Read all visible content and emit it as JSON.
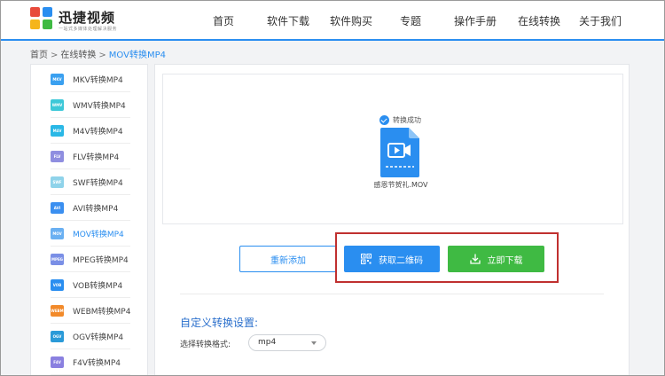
{
  "header": {
    "brand": "迅捷视频",
    "brand_sub": "一站式多媒体处理解决服务",
    "nav": [
      "首页",
      "软件下载",
      "软件购买",
      "专题",
      "操作手册",
      "在线转换",
      "关于我们"
    ]
  },
  "breadcrumb": {
    "home": "首页",
    "sep": ">",
    "section": "在线转换",
    "current": "MOV转换MP4"
  },
  "sidebar": {
    "items": [
      {
        "badge": "MKV",
        "label": "MKV转换MP4",
        "color": "#3aa0f0"
      },
      {
        "badge": "WMV",
        "label": "WMV转换MP4",
        "color": "#3dc8d8"
      },
      {
        "badge": "M4V",
        "label": "M4V转换MP4",
        "color": "#2ab8e6"
      },
      {
        "badge": "FLV",
        "label": "FLV转换MP4",
        "color": "#8f8ee0"
      },
      {
        "badge": "SWF",
        "label": "SWF转换MP4",
        "color": "#8fd3ea"
      },
      {
        "badge": "AVI",
        "label": "AVI转换MP4",
        "color": "#3a8ff0"
      },
      {
        "badge": "MOV",
        "label": "MOV转换MP4",
        "color": "#6ab0f2"
      },
      {
        "badge": "MPEG",
        "label": "MPEG转换MP4",
        "color": "#7a8fe6"
      },
      {
        "badge": "VOB",
        "label": "VOB转换MP4",
        "color": "#2a8ef0"
      },
      {
        "badge": "WEBM",
        "label": "WEBM转换MP4",
        "color": "#f28a2a"
      },
      {
        "badge": "OGV",
        "label": "OGV转换MP4",
        "color": "#2a9ad8"
      },
      {
        "badge": "F4V",
        "label": "F4V转换MP4",
        "color": "#8a80e0"
      }
    ],
    "active_index": 6
  },
  "main": {
    "success_text": "转换成功",
    "file_name": "感恩节贺礼.MOV",
    "buttons": {
      "readd": "重新添加",
      "qr": "获取二维码",
      "download": "立即下载"
    },
    "custom_title": "自定义转换设置:",
    "format_label": "选择转换格式:",
    "format_value": "mp4"
  },
  "colors": {
    "accent": "#2a8ef0",
    "download": "#3fba43",
    "highlight": "#c0302f"
  }
}
